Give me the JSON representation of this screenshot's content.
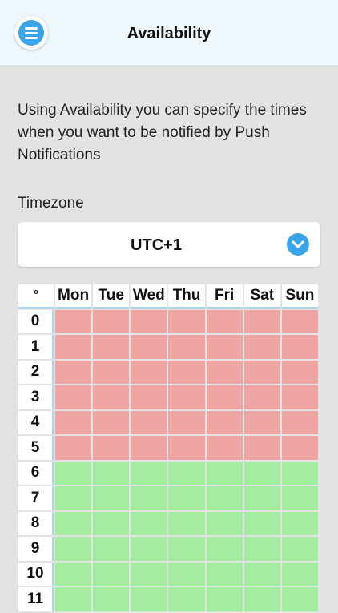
{
  "header": {
    "title": "Availability",
    "menu_icon": "hamburger-menu-icon"
  },
  "intro": "Using Availability you can specify the times when you want to be notified by Push Notifications",
  "timezone": {
    "label": "Timezone",
    "value": "UTC+1",
    "chevron_icon": "chevron-down-icon"
  },
  "schedule": {
    "corner_label": "°",
    "days": [
      "Mon",
      "Tue",
      "Wed",
      "Thu",
      "Fri",
      "Sat",
      "Sun"
    ],
    "hours": [
      "0",
      "1",
      "2",
      "3",
      "4",
      "5",
      "6",
      "7",
      "8",
      "9",
      "10",
      "11"
    ],
    "unavailable_hours": [
      "0",
      "1",
      "2",
      "3",
      "4",
      "5"
    ],
    "colors": {
      "unavailable": "#eea5a4",
      "available": "#a3eca0",
      "accent": "#3aa5e8"
    }
  }
}
